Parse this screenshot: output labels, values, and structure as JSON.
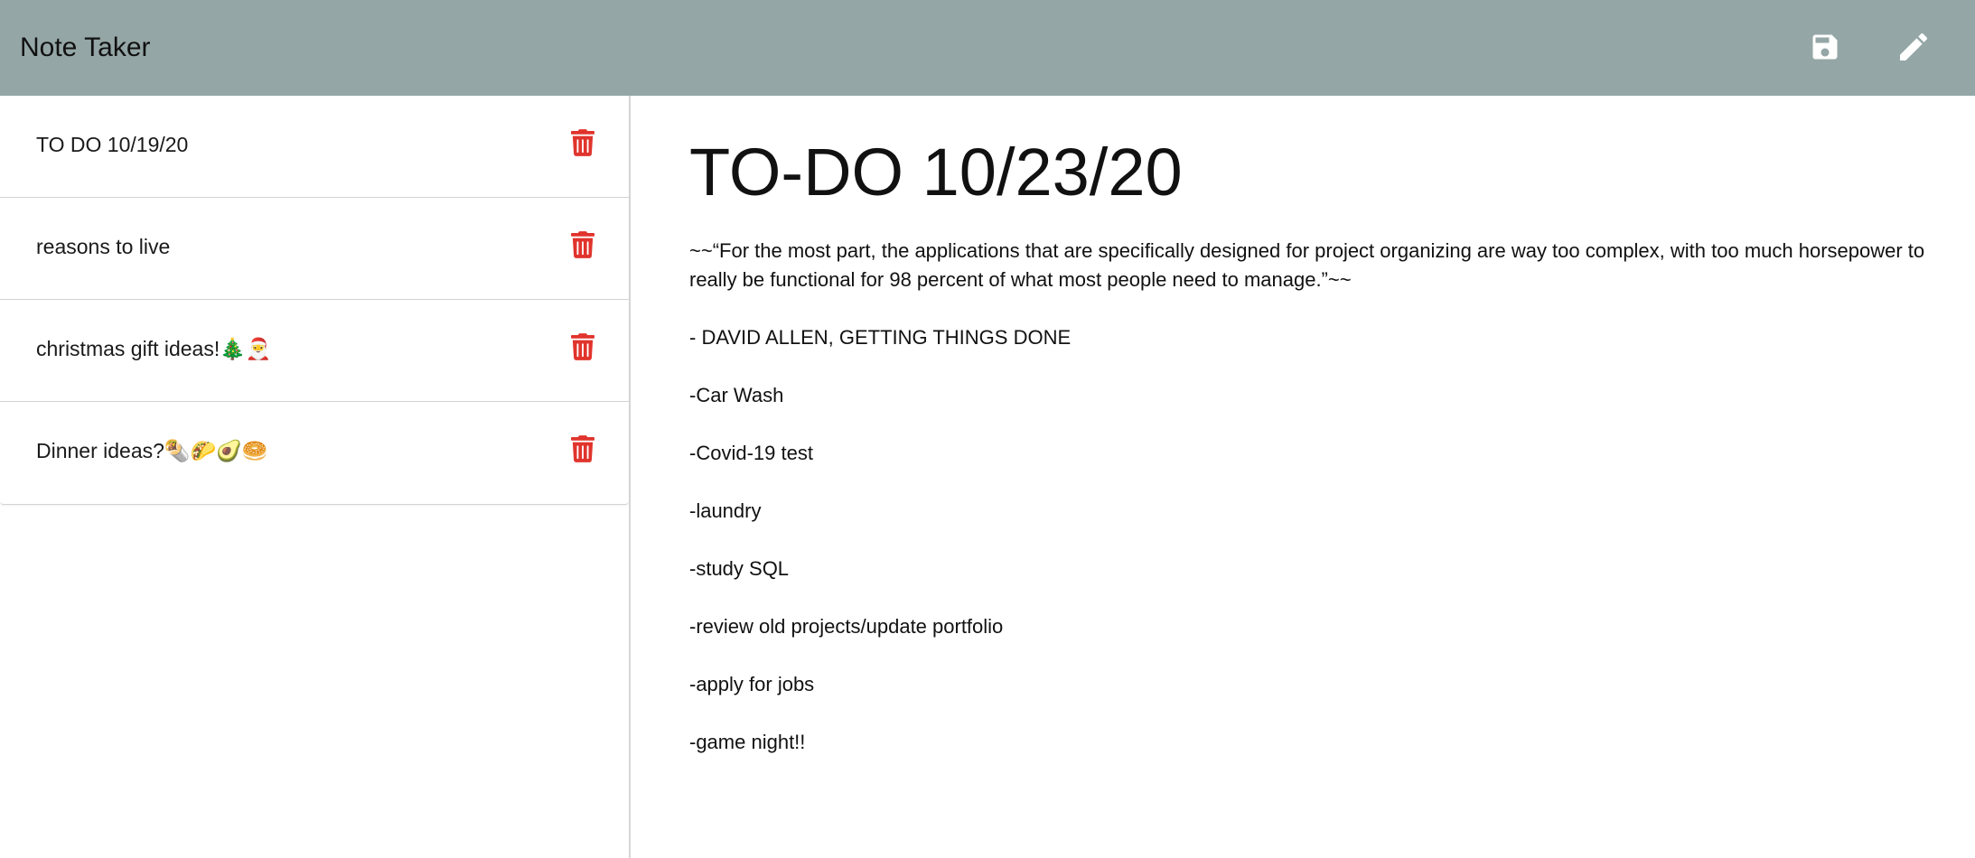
{
  "app": {
    "title": "Note Taker"
  },
  "toolbar": {
    "save_icon": "save-icon",
    "edit_icon": "pencil-icon"
  },
  "sidebar": {
    "notes": [
      {
        "title": "TO DO 10/19/20"
      },
      {
        "title": "reasons to live"
      },
      {
        "title": "christmas gift ideas!🎄🎅"
      },
      {
        "title": "Dinner ideas?🌯🌮🥑🥯"
      }
    ],
    "delete_icon": "trash-icon"
  },
  "editor": {
    "title": "TO-DO 10/23/20",
    "lines": [
      "~~“For the most part, the applications that are specifically designed for project organizing are way too complex, with too much horsepower to really be functional for 98 percent of what most people need to manage.”~~",
      "-  DAVID ALLEN, GETTING THINGS DONE",
      "-Car Wash",
      "-Covid-19 test",
      "-laundry",
      "-study SQL",
      "-review old projects/update portfolio",
      "-apply for jobs",
      "-game night!!"
    ]
  },
  "colors": {
    "navbar": "#95a6a6",
    "icon": "#ffffff",
    "delete": "#e0342d"
  }
}
